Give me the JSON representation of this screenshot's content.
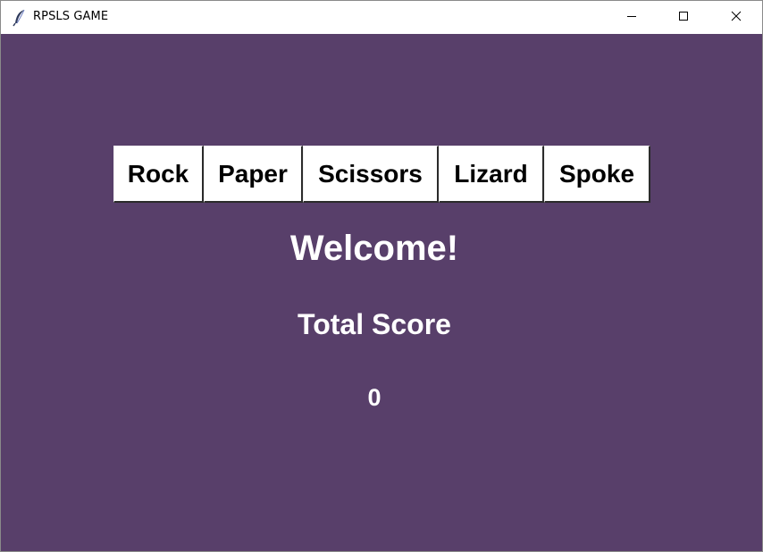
{
  "window": {
    "title": "RPSLS GAME",
    "icon": "feather-icon"
  },
  "colors": {
    "background": "#583f6a",
    "button_bg": "#ffffff",
    "text_on_bg": "#ffffff"
  },
  "choices": [
    {
      "label": "Rock"
    },
    {
      "label": "Paper"
    },
    {
      "label": "Scissors"
    },
    {
      "label": "Lizard"
    },
    {
      "label": "Spoke"
    }
  ],
  "status": {
    "message": "Welcome!",
    "score_label": "Total Score",
    "score_value": "0"
  }
}
